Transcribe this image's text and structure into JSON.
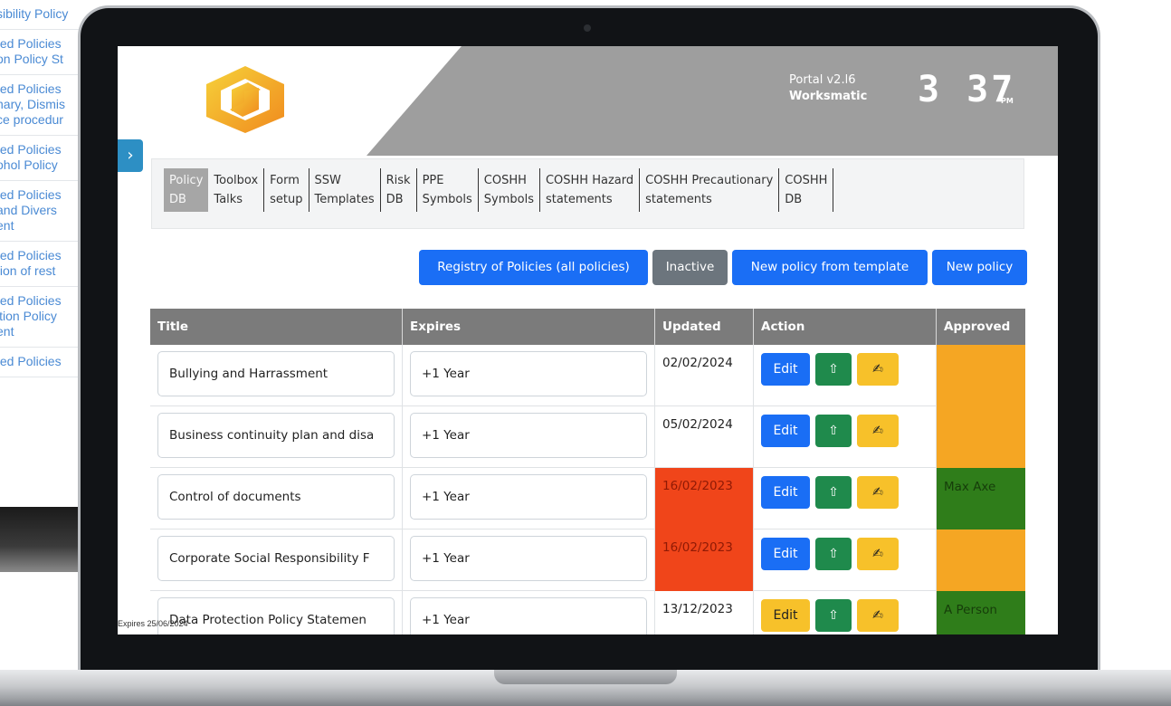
{
  "background_window": {
    "items": [
      [
        "sibility Policy"
      ],
      [
        "ted Policies",
        "on Policy St"
      ],
      [
        "ted Policies",
        "nary, Dismis",
        "ce procedur"
      ],
      [
        "ted Policies",
        "ohol Policy"
      ],
      [
        "ted Policies",
        " and Divers",
        "ent"
      ],
      [
        "ted Policies",
        "tion of rest"
      ],
      [
        "ted Policies",
        "ition Policy",
        "ent"
      ],
      [
        "ted Policies"
      ]
    ]
  },
  "header": {
    "portal_version": "Portal v2.l6",
    "organisation": "Worksmatic",
    "clock": "3 37",
    "clock_suffix": "PM",
    "colors": {
      "grey_panel": "#9e9e9e",
      "logo": "#f5b82e"
    }
  },
  "sidebar_toggle": {
    "icon": "chevron-right-icon",
    "glyph": "›"
  },
  "tabs": [
    {
      "line1": "Policy",
      "line2": "DB",
      "active": true
    },
    {
      "line1": "Toolbox",
      "line2": "Talks"
    },
    {
      "line1": "Form",
      "line2": "setup"
    },
    {
      "line1": "SSW",
      "line2": "Templates"
    },
    {
      "line1": "Risk",
      "line2": "DB"
    },
    {
      "line1": "PPE",
      "line2": "Symbols"
    },
    {
      "line1": "COSHH",
      "line2": "Symbols"
    },
    {
      "line1": "COSHH Hazard",
      "line2": "statements"
    },
    {
      "line1": "COSHH Precautionary",
      "line2": "statements"
    },
    {
      "line1": "COSHH",
      "line2": "DB"
    }
  ],
  "toolbar": {
    "registry": "Registry of Policies (all policies)",
    "inactive": "Inactive",
    "new_from_template": "New policy from template",
    "new_policy": "New policy"
  },
  "table": {
    "headers": {
      "title": "Title",
      "expires": "Expires",
      "updated": "Updated",
      "action": "Action",
      "approved": "Approved"
    },
    "action_labels": {
      "edit": "Edit",
      "upload_glyph": "⇧",
      "sign_glyph": "✍"
    },
    "rows": [
      {
        "title": "Bullying and Harrassment",
        "expires": "+1 Year",
        "updated": "02/02/2024",
        "expired": false,
        "edit_style": "blue",
        "approved": "",
        "approved_status": "orange"
      },
      {
        "title": "Business continuity plan and disa",
        "expires": "+1 Year",
        "updated": "05/02/2024",
        "expired": false,
        "edit_style": "blue",
        "approved": "",
        "approved_status": "orange"
      },
      {
        "title": "Control of documents",
        "expires": "+1 Year",
        "updated": "16/02/2023",
        "expired": true,
        "edit_style": "blue",
        "approved": "Max Axe",
        "approved_status": "green"
      },
      {
        "title": "Corporate Social Responsibility F",
        "expires": "+1 Year",
        "updated": "16/02/2023",
        "expired": true,
        "edit_style": "blue",
        "approved": "",
        "approved_status": "orange"
      },
      {
        "title": "Data Protection Policy Statemen",
        "expires": "+1 Year",
        "updated": "13/12/2023",
        "expired": false,
        "edit_style": "yellow",
        "approved": "A Person",
        "approved_status": "green"
      }
    ]
  },
  "footer": {
    "expires_text": "Expires 25/06/2024"
  }
}
